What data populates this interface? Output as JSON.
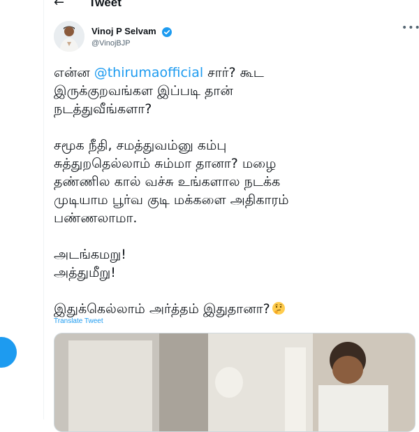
{
  "header": {
    "title": "Tweet",
    "back_icon": "arrow-left-icon"
  },
  "tweet": {
    "author_name": "Vinoj P Selvam",
    "author_handle": "@VinojBJP",
    "verified": true,
    "paragraphs": [
      {
        "prefix": "என்ன ",
        "mention": "@thirumaofficial",
        "lines": [
          " சார்? கூட",
          "இருக்குறவங்கள இப்படி தான்",
          "நடத்துவீங்களா?"
        ]
      },
      {
        "lines": [
          "சமூக நீதி, சமத்துவம்னு கம்பு",
          "சுத்துறதெல்லாம் சும்மா தானா? மழை",
          "தண்ணில கால் வச்சு உங்களால நடக்க",
          "முடியாம பூர்வ குடி மக்களை அதிகாரம்",
          "பண்ணலாமா."
        ]
      },
      {
        "lines": [
          "அடங்கமறு!",
          "அத்துமீறு!"
        ]
      },
      {
        "lines": [
          "இதுக்கெல்லாம் அர்த்தம் இதுதானா?"
        ],
        "emoji": "thinking-face"
      }
    ],
    "translate_label": "Translate Tweet"
  },
  "colors": {
    "accent": "#1d9bf0",
    "text": "#0f1419",
    "muted": "#536471",
    "border": "#cfd9de"
  }
}
